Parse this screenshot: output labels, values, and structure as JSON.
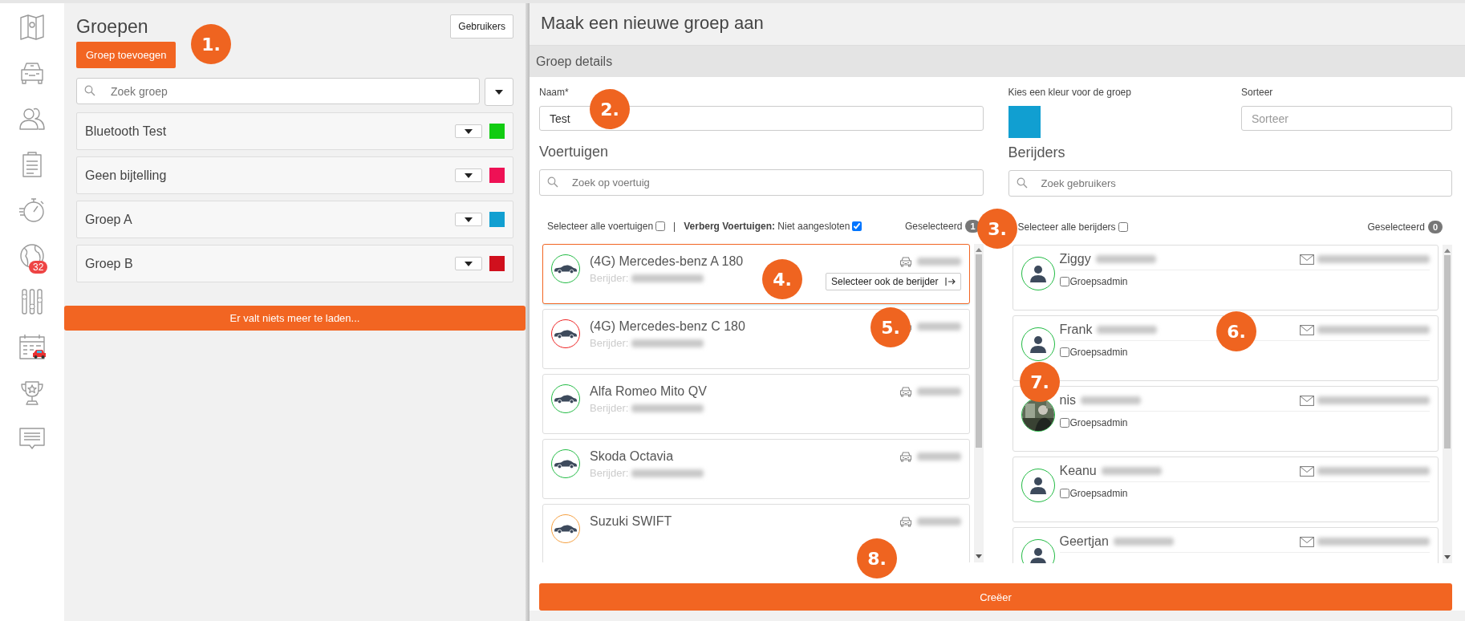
{
  "sidebar": {
    "badge": "32"
  },
  "groups_panel": {
    "title": "Groepen",
    "users_button": "Gebruikers",
    "add_button": "Groep toevoegen",
    "search_placeholder": "Zoek groep",
    "groups": [
      {
        "name": "Bluetooth Test",
        "color": "#11cc11"
      },
      {
        "name": "Geen bijtelling",
        "color": "#ee1155"
      },
      {
        "name": "Groep A",
        "color": "#119fd1"
      },
      {
        "name": "Groep B",
        "color": "#d0101d"
      }
    ],
    "load_more": "Er valt niets meer te laden..."
  },
  "form": {
    "title": "Maak een nieuwe groep aan",
    "section": "Groep details",
    "name_label": "Naam*",
    "name_value": "Test",
    "color_label": "Kies een kleur voor de groep",
    "color": "#119fd1",
    "sort_label": "Sorteer",
    "sort_placeholder": "Sorteer"
  },
  "vehicles": {
    "heading": "Voertuigen",
    "search_placeholder": "Zoek op voertuig",
    "select_all_label": "Selecteer alle voertuigen",
    "select_all": false,
    "separator": "|",
    "hide_label": "Verberg Voertuigen:",
    "hide_value": "Niet aangesloten",
    "hide": true,
    "selected_label": "Geselecteerd",
    "selected_count": "1",
    "items": [
      {
        "name": "(4G) Mercedes-benz A 180",
        "driver_label": "Berijder:",
        "color": "#22bb44",
        "selected": true,
        "action": "Selecteer ook de berijder"
      },
      {
        "name": "(4G) Mercedes-benz C 180",
        "driver_label": "Berijder:",
        "color": "#ee2222",
        "selected": false
      },
      {
        "name": "Alfa Romeo Mito QV",
        "driver_label": "Berijder:",
        "color": "#22bb44",
        "selected": false
      },
      {
        "name": "Skoda Octavia",
        "driver_label": "Berijder:",
        "color": "#22bb44",
        "selected": false
      },
      {
        "name": "Suzuki SWIFT",
        "color": "#f5a040",
        "selected": false
      }
    ]
  },
  "drivers": {
    "heading": "Berijders",
    "search_placeholder": "Zoek gebruikers",
    "select_all_label": "Selecteer alle berijders",
    "select_all": false,
    "selected_label": "Geselecteerd",
    "selected_count": "0",
    "items": [
      {
        "name": "Ziggy",
        "kind": "silhouette",
        "admin_label": "Groepsadmin",
        "admin": false
      },
      {
        "name": "Frank",
        "kind": "silhouette",
        "admin_label": "Groepsadmin",
        "admin": false
      },
      {
        "name": "nis",
        "admin_label": "Groepsadmin",
        "admin": false
      },
      {
        "name": "Keanu",
        "kind": "silhouette",
        "admin_label": "Groepsadmin",
        "admin": false
      },
      {
        "name": "Geertjan",
        "kind": "silhouette"
      }
    ]
  },
  "create_button": "Creëer",
  "callouts": [
    "1.",
    "2.",
    "3.",
    "4.",
    "5.",
    "6.",
    "7.",
    "8."
  ]
}
